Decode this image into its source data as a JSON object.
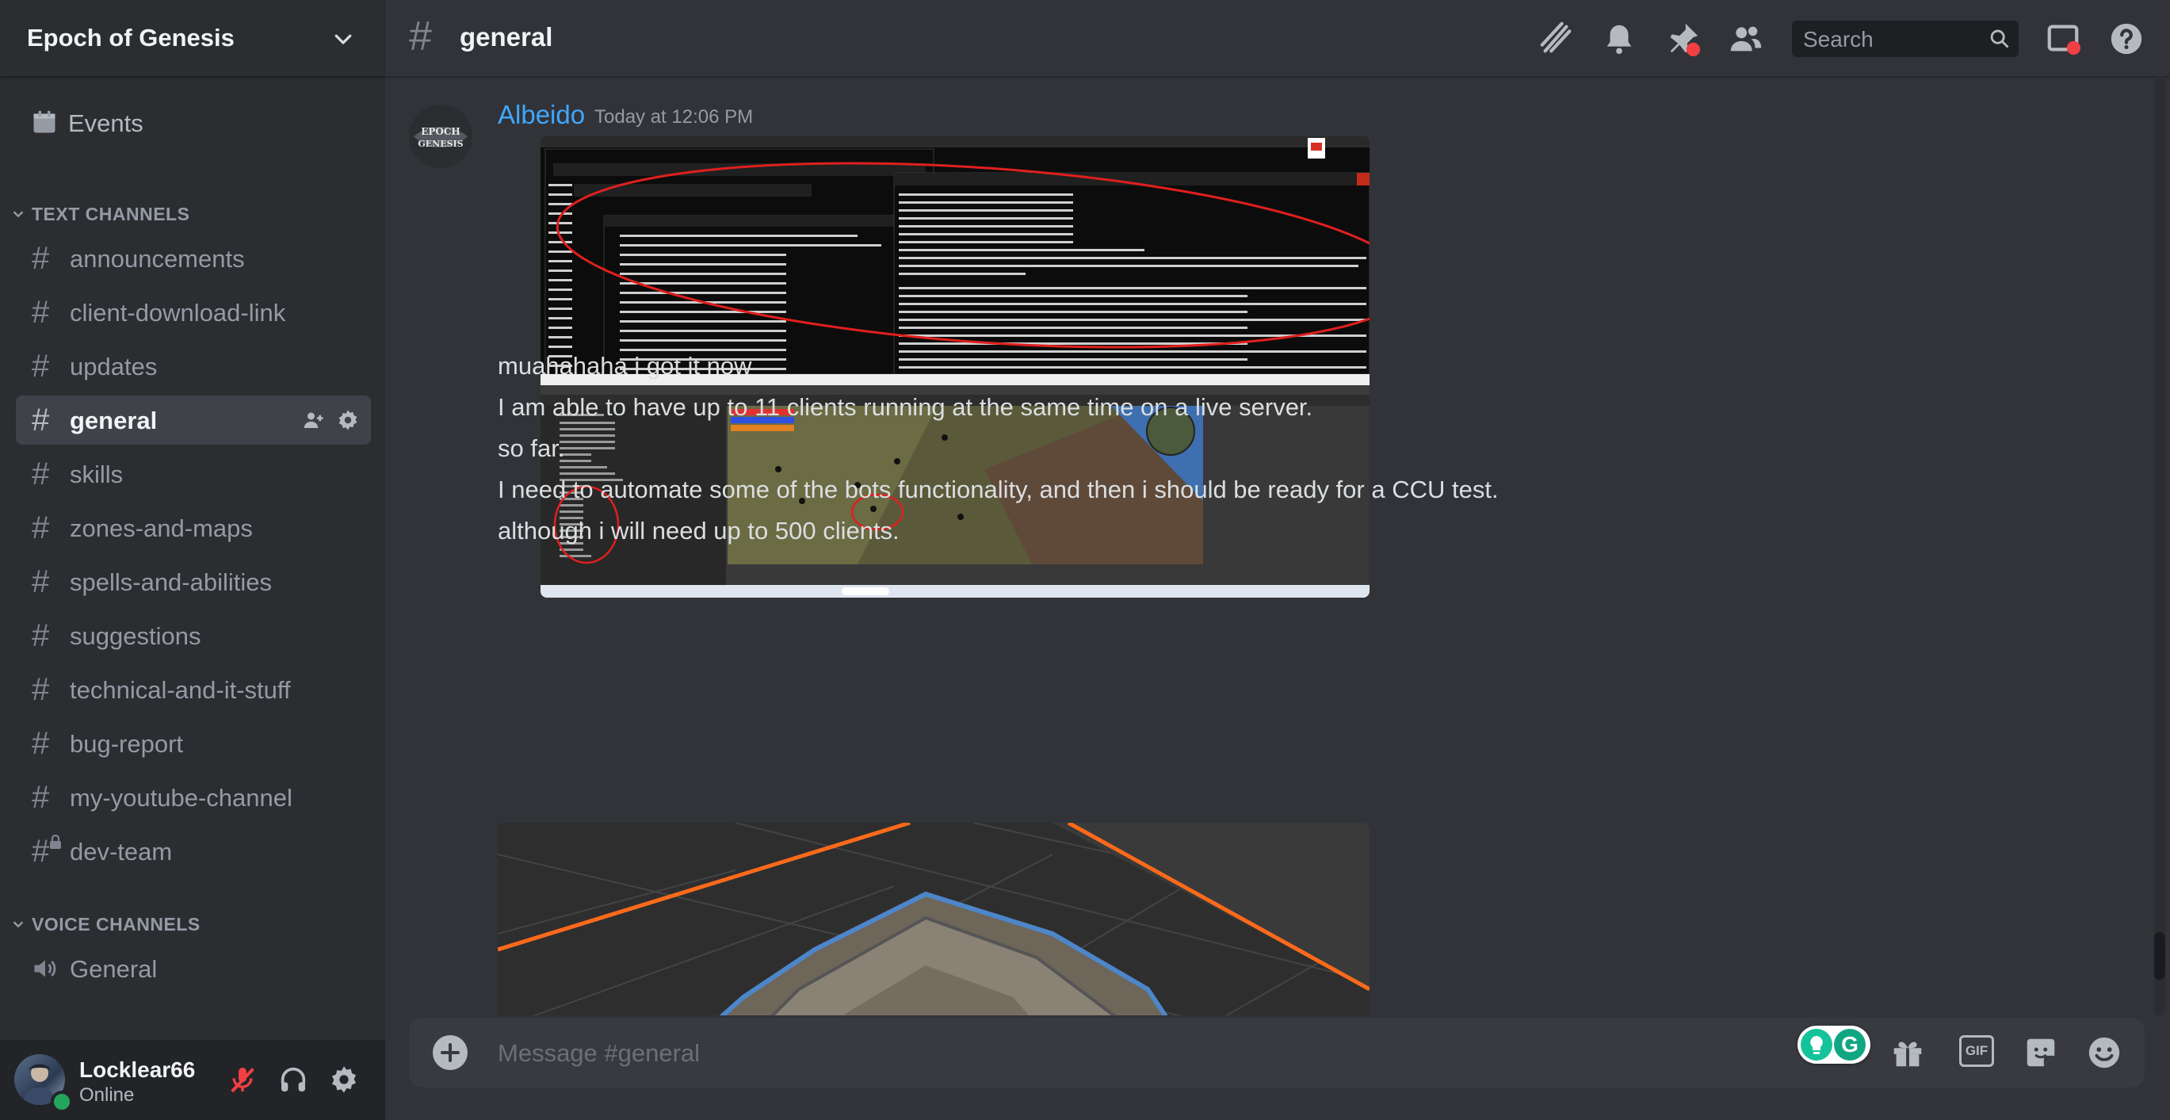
{
  "server": {
    "name": "Epoch of Genesis"
  },
  "sidebar": {
    "events_label": "Events",
    "text_category": "TEXT CHANNELS",
    "voice_category": "VOICE CHANNELS",
    "text_channels": [
      {
        "label": "announcements"
      },
      {
        "label": "client-download-link"
      },
      {
        "label": "updates"
      },
      {
        "label": "general",
        "active": true
      },
      {
        "label": "skills"
      },
      {
        "label": "zones-and-maps"
      },
      {
        "label": "spells-and-abilities"
      },
      {
        "label": "suggestions"
      },
      {
        "label": "technical-and-it-stuff"
      },
      {
        "label": "bug-report"
      },
      {
        "label": "my-youtube-channel"
      },
      {
        "label": "dev-team",
        "locked": true
      }
    ],
    "voice_channels": [
      {
        "label": "General"
      }
    ]
  },
  "user": {
    "name": "Locklear66",
    "status": "Online"
  },
  "header": {
    "channel": "general",
    "search_placeholder": "Search"
  },
  "message": {
    "author": "Albeido",
    "timestamp": "Today at 12:06 PM",
    "avatar_text": "EPOCH GENESIS",
    "lines": [
      "muahahaha i got it now",
      "I am able to have up to 11 clients running at the same time on a live server.",
      "so far.",
      "I need to automate some of the bots functionality, and then i should be ready for a CCU test.",
      "although i will need up to 500 clients."
    ]
  },
  "composer": {
    "placeholder": "Message #general",
    "gif_label": "GIF"
  },
  "colors": {
    "background": "#313338",
    "sidebar": "#2b2d31",
    "user_panel": "#232428",
    "author": "#3fa7ff",
    "online": "#23a55a",
    "notification": "#f23f43"
  }
}
